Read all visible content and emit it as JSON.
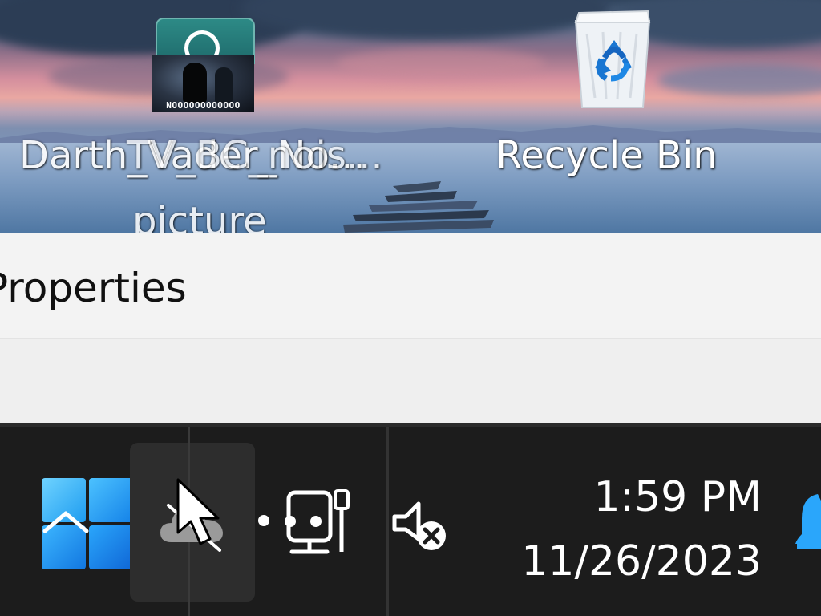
{
  "desktop": {
    "icons": [
      {
        "label": "Darth_Vader_No...",
        "thumbnail_caption": "NOOOOOOOOOOOO"
      },
      {
        "label": "TV_BC_nois...",
        "label_line2": "picture"
      },
      {
        "label": "Recycle Bin"
      }
    ]
  },
  "context_menu": {
    "properties_label": "Properties"
  },
  "taskbar": {
    "start_icon": "windows-logo-icon",
    "tray_icons": [
      "onedrive-offline-icon",
      "network-ethernet-icon",
      "volume-muted-icon",
      "notification-bell-icon"
    ],
    "clock": {
      "time": "1:59 PM",
      "date": "11/26/2023"
    }
  },
  "colors": {
    "taskbar_bg": "#1c1c1c",
    "accent_blue": "#1e90ff",
    "panel_bg": "#f3f3f3",
    "recycle_blue": "#1565c0"
  }
}
